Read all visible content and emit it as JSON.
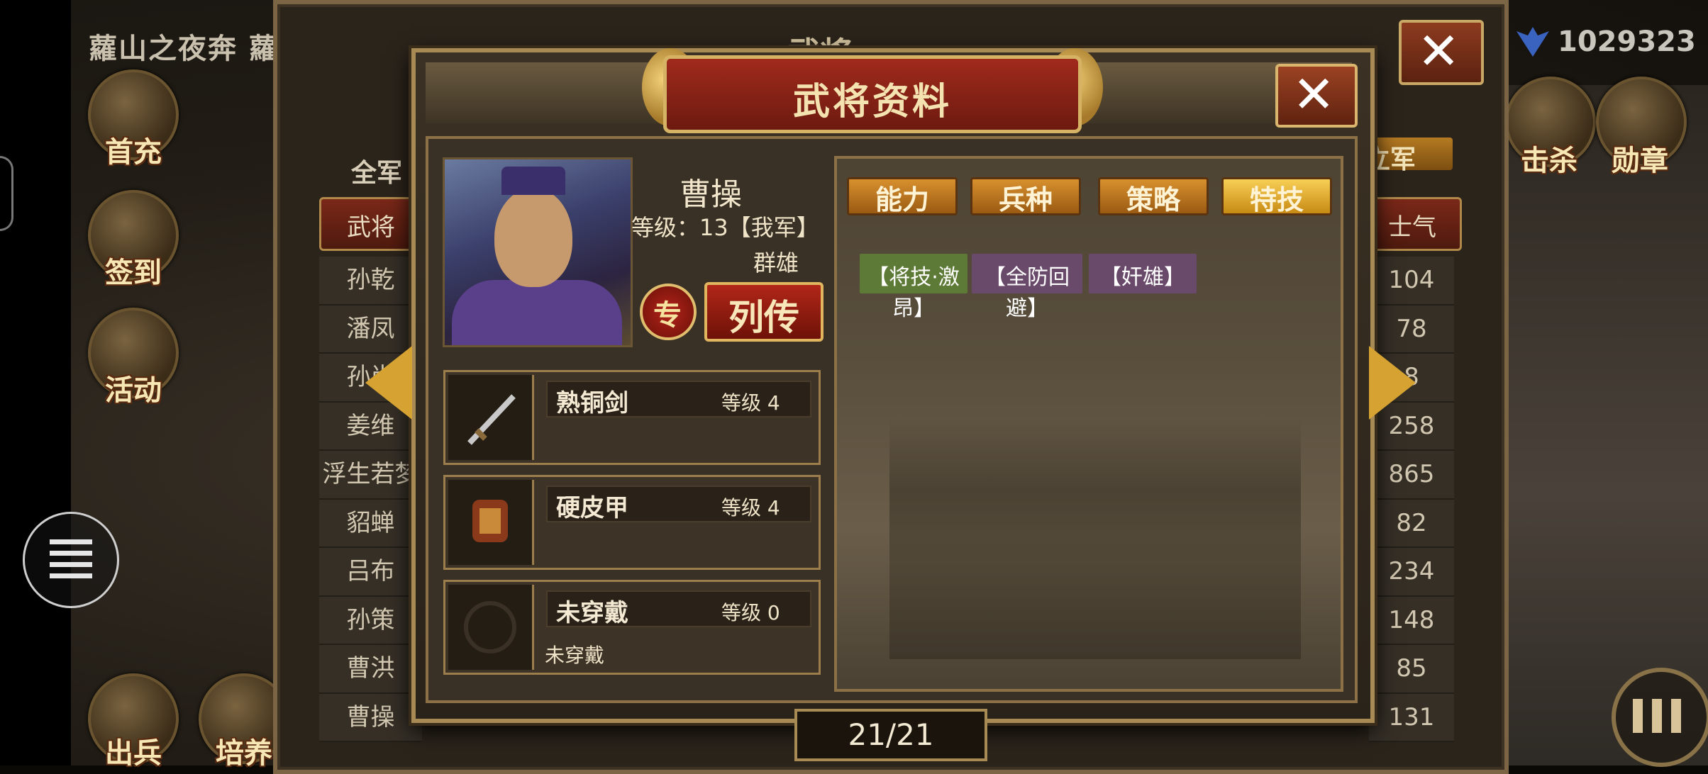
{
  "background": {
    "banner_title": "蘿山之夜奔 蘿",
    "panel_title": "武将",
    "currency_value": "1029323",
    "tab_all": "全军",
    "col_general": "武将",
    "col_morale": "士气",
    "lijun_label": "立军",
    "names": [
      "孙乾",
      "潘凤",
      "孙尚",
      "姜维",
      "浮生若梦",
      "貂蝉",
      "吕布",
      "孙策",
      "曹洪",
      "曹操"
    ],
    "values": [
      "104",
      "78",
      "8",
      "258",
      "865",
      "82",
      "234",
      "148",
      "85",
      "131"
    ]
  },
  "left_menu": [
    {
      "label": "首充",
      "icon": "gift-icon"
    },
    {
      "label": "签到",
      "icon": "checkin-icon"
    },
    {
      "label": "活动",
      "icon": "chest-icon"
    },
    {
      "label": "出兵",
      "icon": "flag-icon"
    },
    {
      "label": "培养",
      "icon": "horse-icon"
    }
  ],
  "right_menu": [
    {
      "label": "击杀",
      "icon": "swords-icon"
    },
    {
      "label": "勋章",
      "icon": "medal-icon"
    }
  ],
  "dialog": {
    "title": "武将资料",
    "hero": {
      "name": "曹操",
      "level_text": "等级：13【我军】",
      "class": "群雄",
      "specialty_btn": "专",
      "biography_btn": "列传"
    },
    "equipment": [
      {
        "name": "熟铜剑",
        "level": "等级 4",
        "desc": "",
        "icon": "sword-icon"
      },
      {
        "name": "硬皮甲",
        "level": "等级 4",
        "desc": "",
        "icon": "armor-icon"
      },
      {
        "name": "未穿戴",
        "level": "等级 0",
        "desc": "未穿戴",
        "icon": "dragon-icon"
      }
    ],
    "tabs": [
      "能力",
      "兵种",
      "策略",
      "特技"
    ],
    "active_tab": "特技",
    "skills": [
      {
        "label": "【将技·激昂】",
        "color": "#5d7a36"
      },
      {
        "label": "【全防回避】",
        "color": "#6a4a6a"
      },
      {
        "label": "【奸雄】",
        "color": "#6a4a6a"
      }
    ]
  },
  "pager": "21/21",
  "colors": {
    "accent_gold": "#d6a332",
    "title_red": "#a02a1c",
    "frame": "#a88a55"
  }
}
